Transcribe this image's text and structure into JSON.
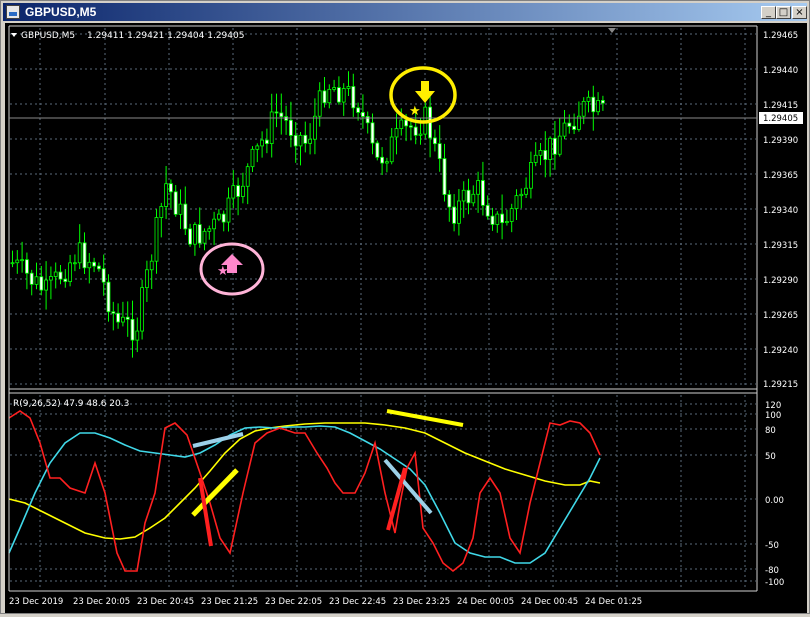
{
  "window": {
    "title": "GBPUSD,M5",
    "buttons": {
      "minimize": "_",
      "maximize": "□",
      "close": "×"
    }
  },
  "chart_header": {
    "symbol": "GBPUSD,M5",
    "ohlc": "1.29411 1.29421 1.29404 1.29405"
  },
  "price_axis": {
    "ticks": [
      "1.29465",
      "1.29440",
      "1.29415",
      "1.29390",
      "1.29365",
      "1.29340",
      "1.29315",
      "1.29290",
      "1.29265",
      "1.29240",
      "1.29215"
    ],
    "current_price": "1.29405"
  },
  "indicator": {
    "label": "R(9,26,52) 47.9 48.6 20.3",
    "ticks": [
      "120",
      "100",
      "80",
      "50",
      "0.00",
      "-50",
      "-80",
      "-100"
    ]
  },
  "time_axis": {
    "labels": [
      "23 Dec 2019",
      "23 Dec 20:05",
      "23 Dec 20:45",
      "23 Dec 21:25",
      "23 Dec 22:05",
      "23 Dec 22:45",
      "23 Dec 23:25",
      "24 Dec 00:05",
      "24 Dec 00:45",
      "24 Dec 01:25"
    ]
  },
  "colors": {
    "background": "#000000",
    "candle": "#00ff00",
    "bull_body": "#000000",
    "bear_body": "#ffffff",
    "grid": "#5a6a7a",
    "indicator_red": "#ff2020",
    "indicator_cyan": "#40d8e8",
    "indicator_yellow": "#ffff00",
    "annotation_pink": "#ff88cc",
    "annotation_yellow": "#ffee00"
  },
  "icons": [
    "up-arrow-icon",
    "down-arrow-icon",
    "star-icon"
  ]
}
